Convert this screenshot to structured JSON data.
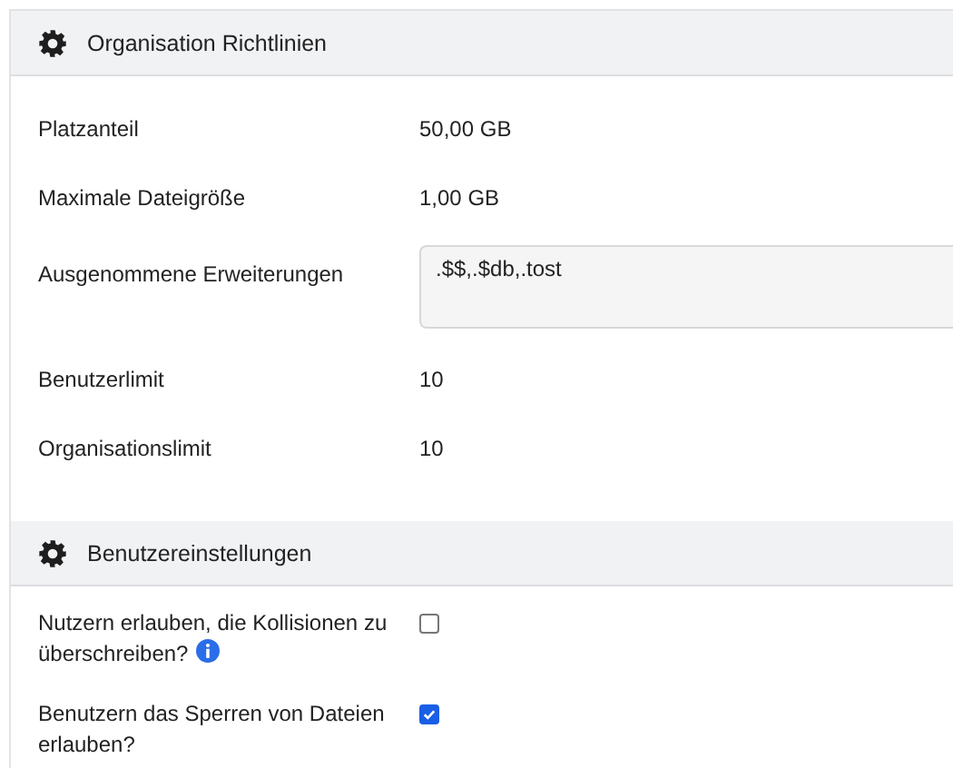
{
  "sections": [
    {
      "title": "Organisation Richtlinien",
      "rows": [
        {
          "kind": "text",
          "label": "Platzanteil",
          "value": "50,00 GB"
        },
        {
          "kind": "text",
          "label": "Maximale Dateigröße",
          "value": "1,00 GB"
        },
        {
          "kind": "textarea",
          "label": "Ausgenommene Erweiterungen",
          "value": ".$$,.$db,.tost"
        },
        {
          "kind": "text",
          "label": "Benutzerlimit",
          "value": "10"
        },
        {
          "kind": "text",
          "label": "Organisationslimit",
          "value": "10"
        }
      ]
    },
    {
      "title": "Benutzereinstellungen",
      "rows": [
        {
          "kind": "checkbox",
          "label": "Nutzern erlauben, die Kollisionen zu überschreiben?",
          "info": true,
          "checked": false
        },
        {
          "kind": "checkbox",
          "label": "Benutzern das Sperren von Dateien erlauben?",
          "info": false,
          "checked": true
        }
      ]
    }
  ]
}
